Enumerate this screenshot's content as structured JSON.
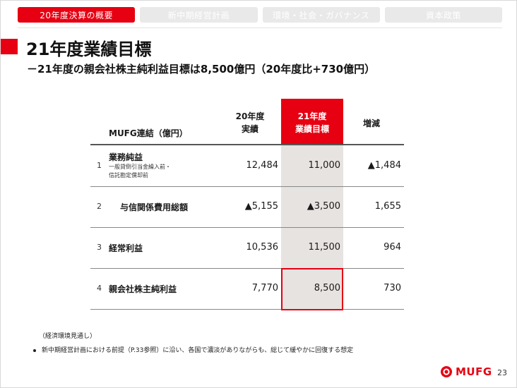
{
  "tabs": [
    {
      "label": "20年度決算の概要",
      "active": true
    },
    {
      "label": "新中期経営計画",
      "active": false
    },
    {
      "label": "環境・社会・ガバナンス",
      "active": false
    },
    {
      "label": "資本政策",
      "active": false
    }
  ],
  "title": "21年度業績目標",
  "subtitle": "－21年度の親会社株主純利益目標は8,500億円（20年度比+730億円）",
  "table": {
    "unit_label": "MUFG連結（億円）",
    "col_fy20": [
      "20年度",
      "実績"
    ],
    "col_fy21": [
      "21年度",
      "業績目標"
    ],
    "col_diff": "増減",
    "rows": [
      {
        "no": "1",
        "label": "業務純益",
        "note": [
          "一般貸倒引当金繰入前・",
          "信託勘定償却前"
        ],
        "fy20": "12,484",
        "fy21": "11,000",
        "diff": "▲1,484"
      },
      {
        "no": "2",
        "label": "与信関係費用総額",
        "note": [],
        "fy20": "▲5,155",
        "fy21": "▲3,500",
        "diff": "1,655"
      },
      {
        "no": "3",
        "label": "経常利益",
        "note": [],
        "fy20": "10,536",
        "fy21": "11,500",
        "diff": "964"
      },
      {
        "no": "4",
        "label": "親会社株主純利益",
        "note": [],
        "fy20": "7,770",
        "fy21": "8,500",
        "diff": "730"
      }
    ]
  },
  "footnote": {
    "heading": "（経済環境見通し）",
    "bullet": "新中期経営計画における前提（P.33参照）に沿い、各国で濃淡がありながらも、総じて緩やかに回復する想定"
  },
  "logo_text": "MUFG",
  "page_number": "23",
  "colors": {
    "accent": "#e60012",
    "highlight": "#e7e3e1",
    "inactive_tab": "#e9e9e9"
  }
}
